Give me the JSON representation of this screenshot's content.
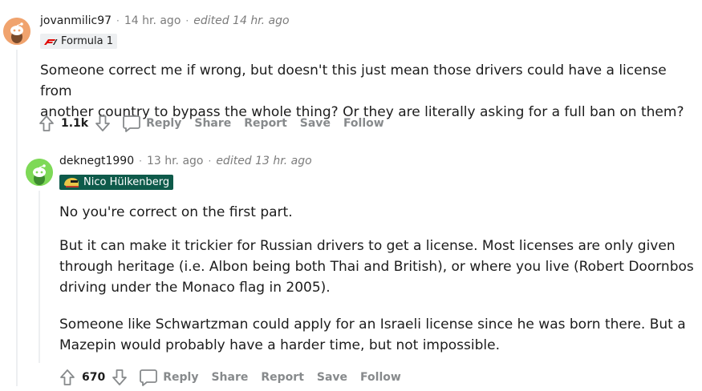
{
  "comments": [
    {
      "author": "jovanmilic97",
      "time": "14 hr. ago",
      "edited": "edited 14 hr. ago",
      "flair": "Formula 1",
      "flair_icon": "f1-logo-icon",
      "lines": [
        "Someone correct me if wrong, but doesn't this just mean those drivers could have a license from",
        "another country to bypass the whole thing? Or they are literally asking for a full ban on them?"
      ],
      "score": "1.1k",
      "actions": {
        "reply": "Reply",
        "share": "Share",
        "report": "Report",
        "save": "Save",
        "follow": "Follow"
      }
    },
    {
      "author": "deknegt1990",
      "time": "13 hr. ago",
      "edited": "edited 13 hr. ago",
      "flair": "Nico Hülkenberg",
      "flair_icon": "race-car-helmet-icon",
      "paragraphs": [
        [
          "No you're correct on the first part."
        ],
        [
          "But it can make it trickier for Russian drivers to get a license. Most licenses are only given",
          "through heritage (i.e. Albon being both Thai and British), or where you live (Robert Doornbos",
          "driving under the Monaco flag in 2005)."
        ],
        [
          "Someone like Schwartzman could apply for an Israeli license since he was born there. But a",
          "Mazepin would probably have a harder time, but not impossible."
        ]
      ],
      "score": "670",
      "actions": {
        "reply": "Reply",
        "share": "Share",
        "report": "Report",
        "save": "Save",
        "follow": "Follow"
      }
    }
  ],
  "separator": "·",
  "colors": {
    "avatar1": "#f0a36e",
    "avatar2": "#7ed957",
    "flair_green": "#0e5a4a",
    "muted": "#878a8c",
    "thread_line": "#edeff1"
  }
}
